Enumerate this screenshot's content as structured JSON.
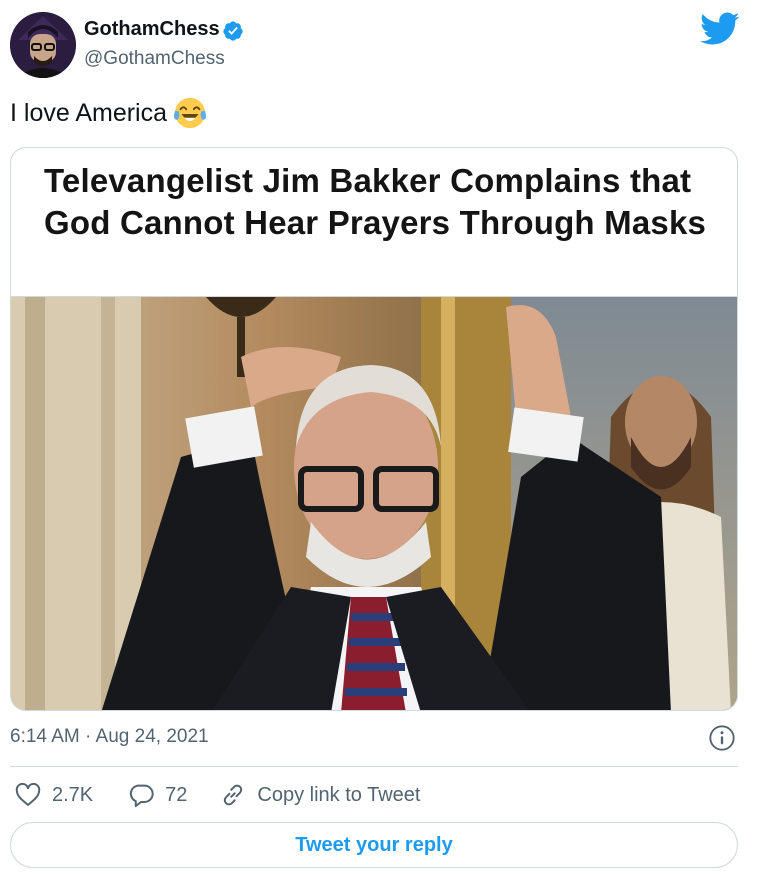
{
  "author": {
    "display_name": "GothamChess",
    "handle": "@GothamChess",
    "avatar_icon": "avatar",
    "verified_icon": "verified-badge-icon"
  },
  "brand_icon": "twitter-bird-icon",
  "tweet": {
    "text": "I love America",
    "emoji_icon": "face-with-tears-of-joy-icon"
  },
  "card": {
    "headline": "Televangelist Jim Bakker Complains that God Cannot Hear Prayers Through Masks",
    "image_icon": "man-with-hands-on-head-photo"
  },
  "meta": {
    "timestamp": "6:14 AM · Aug 24, 2021"
  },
  "actions": {
    "likes": "2.7K",
    "replies": "72",
    "copy_link_label": "Copy link to Tweet"
  },
  "reply_button_label": "Tweet your reply",
  "colors": {
    "accent": "#1d9bf0",
    "secondary_text": "#536471",
    "border": "#cfd9de"
  }
}
